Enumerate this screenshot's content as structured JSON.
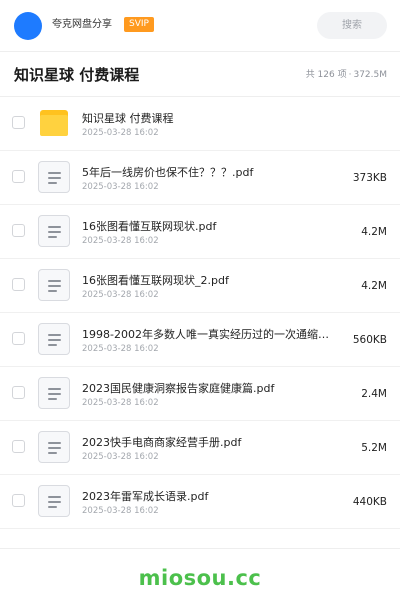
{
  "header": {
    "share_name": "夸克网盘分享",
    "badge": "SVIP",
    "search_placeholder": "搜索"
  },
  "folder": {
    "title": "知识星球 付费课程",
    "count_text": "共 126 项",
    "size_text": "372.5M"
  },
  "files": [
    {
      "name": "知识星球 付费课程",
      "date": "2025-03-28 16:02",
      "size": "",
      "type": "folder"
    },
    {
      "name": "5年后一线房价也保不住？？？.pdf",
      "date": "2025-03-28 16:02",
      "size": "373KB",
      "type": "pdf"
    },
    {
      "name": "16张图看懂互联网现状.pdf",
      "date": "2025-03-28 16:02",
      "size": "4.2M",
      "type": "pdf"
    },
    {
      "name": "16张图看懂互联网现状_2.pdf",
      "date": "2025-03-28 16:02",
      "size": "4.2M",
      "type": "pdf"
    },
    {
      "name": "1998-2002年多数人唯一真实经历过的一次通缩…",
      "date": "2025-03-28 16:02",
      "size": "560KB",
      "type": "pdf"
    },
    {
      "name": "2023国民健康洞察报告家庭健康篇.pdf",
      "date": "2025-03-28 16:02",
      "size": "2.4M",
      "type": "pdf"
    },
    {
      "name": "2023快手电商商家经营手册.pdf",
      "date": "2025-03-28 16:02",
      "size": "5.2M",
      "type": "pdf"
    },
    {
      "name": "2023年雷军成长语录.pdf",
      "date": "2025-03-28 16:02",
      "size": "440KB",
      "type": "pdf"
    }
  ],
  "footer": {
    "watermark": "miosou.cc"
  },
  "colors": {
    "avatar": "#1e7bff",
    "badge": "#ff9a1f",
    "folder": "#ffc21f",
    "watermark": "#4cc04c"
  }
}
